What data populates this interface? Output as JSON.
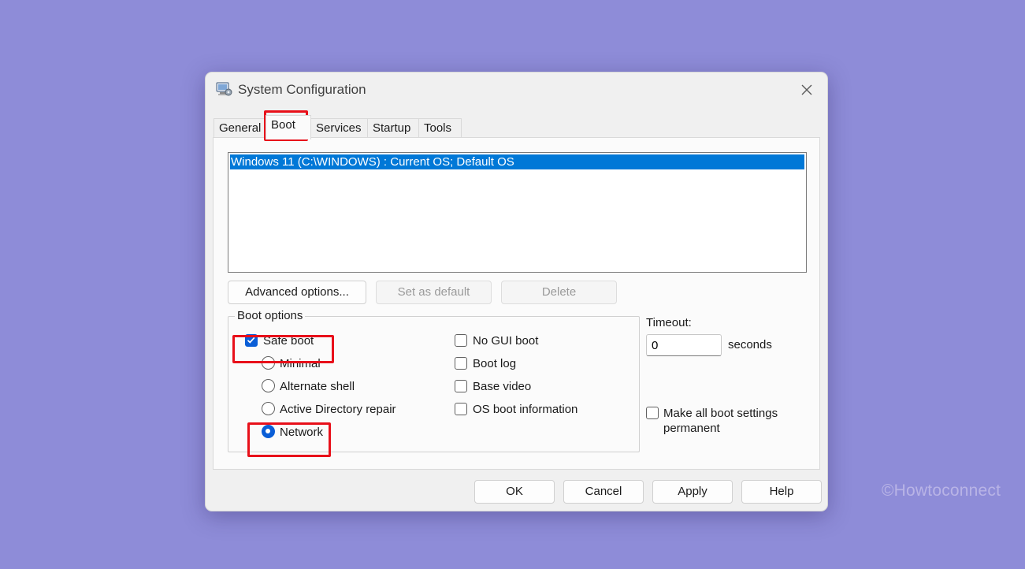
{
  "window": {
    "title": "System Configuration",
    "icon": "system-configuration-icon",
    "close_icon": "close-icon"
  },
  "tabs": [
    {
      "label": "General"
    },
    {
      "label": "Boot",
      "active": true
    },
    {
      "label": "Services"
    },
    {
      "label": "Startup"
    },
    {
      "label": "Tools"
    }
  ],
  "boot": {
    "os_list": [
      "Windows 11 (C:\\WINDOWS) : Current OS; Default OS"
    ],
    "selected_os_index": 0,
    "buttons": {
      "advanced": "Advanced options...",
      "set_default": "Set as default",
      "delete": "Delete"
    },
    "boot_options": {
      "legend": "Boot options",
      "safe_boot": {
        "label": "Safe boot",
        "checked": true
      },
      "radios": [
        {
          "label": "Minimal",
          "checked": false
        },
        {
          "label": "Alternate shell",
          "checked": false
        },
        {
          "label": "Active Directory repair",
          "checked": false
        },
        {
          "label": "Network",
          "checked": true
        }
      ],
      "checkboxes": [
        {
          "label": "No GUI boot",
          "checked": false
        },
        {
          "label": "Boot log",
          "checked": false
        },
        {
          "label": "Base video",
          "checked": false
        },
        {
          "label": "OS boot information",
          "checked": false
        }
      ]
    },
    "timeout": {
      "label": "Timeout:",
      "value": "0",
      "unit": "seconds"
    },
    "make_permanent": {
      "label": "Make all boot settings permanent",
      "checked": false
    }
  },
  "footer": {
    "ok": "OK",
    "cancel": "Cancel",
    "apply": "Apply",
    "help": "Help"
  },
  "watermark": "©Howtoconnect",
  "colors": {
    "background": "#8e8cd8",
    "selection": "#0078d7",
    "checkbox_accent": "#0a5ed7",
    "highlight_box": "#e8101a"
  }
}
